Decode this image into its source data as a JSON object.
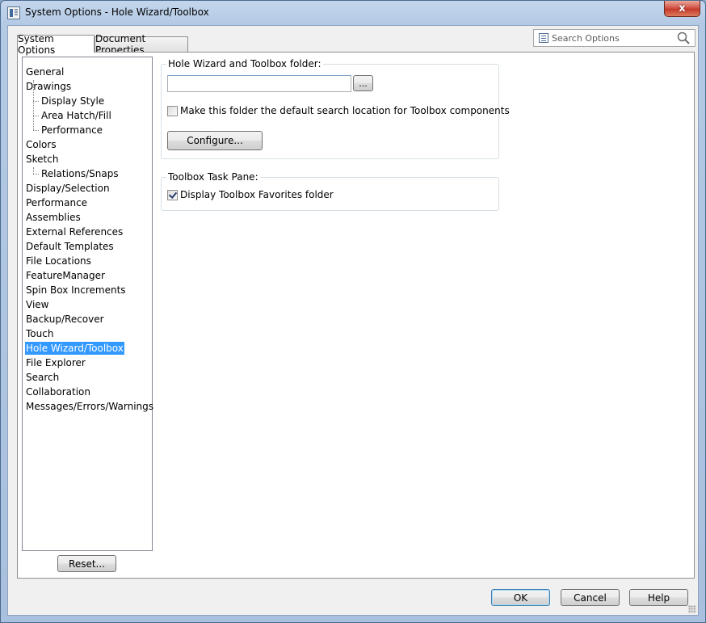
{
  "window": {
    "title": "System Options - Hole Wizard/Toolbox",
    "close_label": "x"
  },
  "tabs": [
    {
      "label": "System Options",
      "active": true
    },
    {
      "label": "Document Properties",
      "active": false
    }
  ],
  "search": {
    "placeholder": "Search Options"
  },
  "tree": {
    "items": [
      {
        "label": "General",
        "level": 0
      },
      {
        "label": "Drawings",
        "level": 0
      },
      {
        "label": "Display Style",
        "level": 1
      },
      {
        "label": "Area Hatch/Fill",
        "level": 1
      },
      {
        "label": "Performance",
        "level": 1
      },
      {
        "label": "Colors",
        "level": 0
      },
      {
        "label": "Sketch",
        "level": 0
      },
      {
        "label": "Relations/Snaps",
        "level": 1
      },
      {
        "label": "Display/Selection",
        "level": 0
      },
      {
        "label": "Performance",
        "level": 0
      },
      {
        "label": "Assemblies",
        "level": 0
      },
      {
        "label": "External References",
        "level": 0
      },
      {
        "label": "Default Templates",
        "level": 0
      },
      {
        "label": "File Locations",
        "level": 0
      },
      {
        "label": "FeatureManager",
        "level": 0
      },
      {
        "label": "Spin Box Increments",
        "level": 0
      },
      {
        "label": "View",
        "level": 0
      },
      {
        "label": "Backup/Recover",
        "level": 0
      },
      {
        "label": "Touch",
        "level": 0
      },
      {
        "label": "Hole Wizard/Toolbox",
        "level": 0,
        "selected": true
      },
      {
        "label": "File Explorer",
        "level": 0
      },
      {
        "label": "Search",
        "level": 0
      },
      {
        "label": "Collaboration",
        "level": 0
      },
      {
        "label": "Messages/Errors/Warnings",
        "level": 0
      }
    ],
    "reset_label": "Reset..."
  },
  "hole_wizard_group": {
    "label": "Hole Wizard and Toolbox folder:",
    "folder_value": "",
    "browse_label": "...",
    "default_search_checkbox": {
      "label": "Make this folder the default search location for Toolbox components",
      "checked": false
    },
    "configure_label": "Configure..."
  },
  "task_pane_group": {
    "label": "Toolbox Task Pane:",
    "favorites_checkbox": {
      "label": "Display Toolbox Favorites folder",
      "checked": true
    }
  },
  "footer": {
    "ok_label": "OK",
    "cancel_label": "Cancel",
    "help_label": "Help"
  }
}
